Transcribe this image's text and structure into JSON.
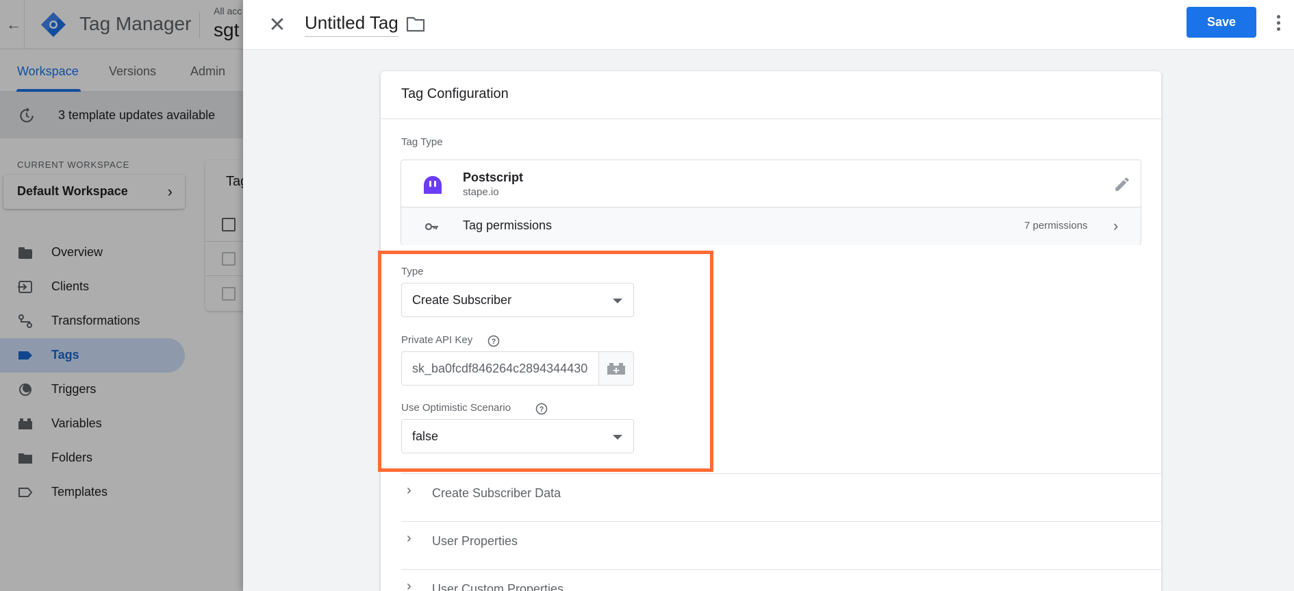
{
  "app": {
    "name": "Tag Manager",
    "account_breadcrumb": "All acc",
    "container_name": "sgt"
  },
  "tabs": [
    {
      "label": "Workspace",
      "active": true
    },
    {
      "label": "Versions",
      "active": false
    },
    {
      "label": "Admin",
      "active": false
    }
  ],
  "updates": {
    "text": "3 template updates available"
  },
  "sidebar": {
    "current_workspace_label": "CURRENT WORKSPACE",
    "workspace_name": "Default Workspace",
    "items": [
      {
        "label": "Overview",
        "icon": "overview-icon",
        "active": false
      },
      {
        "label": "Clients",
        "icon": "clients-icon",
        "active": false
      },
      {
        "label": "Transformations",
        "icon": "transformations-icon",
        "active": false
      },
      {
        "label": "Tags",
        "icon": "tag-icon",
        "active": true
      },
      {
        "label": "Triggers",
        "icon": "triggers-icon",
        "active": false
      },
      {
        "label": "Variables",
        "icon": "variables-icon",
        "active": false
      },
      {
        "label": "Folders",
        "icon": "folder-icon",
        "active": false
      },
      {
        "label": "Templates",
        "icon": "templates-icon",
        "active": false
      }
    ]
  },
  "tags_card": {
    "title": "Tag"
  },
  "editor": {
    "title": "Untitled Tag",
    "save_label": "Save",
    "card_title": "Tag Configuration",
    "tag_type_label": "Tag Type",
    "template": {
      "name": "Postscript",
      "vendor": "stape.io"
    },
    "permissions": {
      "label": "Tag permissions",
      "count": "7 permissions"
    },
    "fields": {
      "type": {
        "label": "Type",
        "value": "Create Subscriber"
      },
      "api_key": {
        "label": "Private API Key",
        "value": "sk_ba0fcdf846264c2894344430"
      },
      "optimistic": {
        "label": "Use Optimistic Scenario",
        "value": "false"
      }
    },
    "sections": [
      {
        "label": "Create Subscriber Data"
      },
      {
        "label": "User Properties"
      },
      {
        "label": "User Custom Properties"
      }
    ]
  },
  "colors": {
    "accent": "#1a73e8",
    "highlight": "#ff6b35",
    "template_icon": "#6b3cf5"
  }
}
